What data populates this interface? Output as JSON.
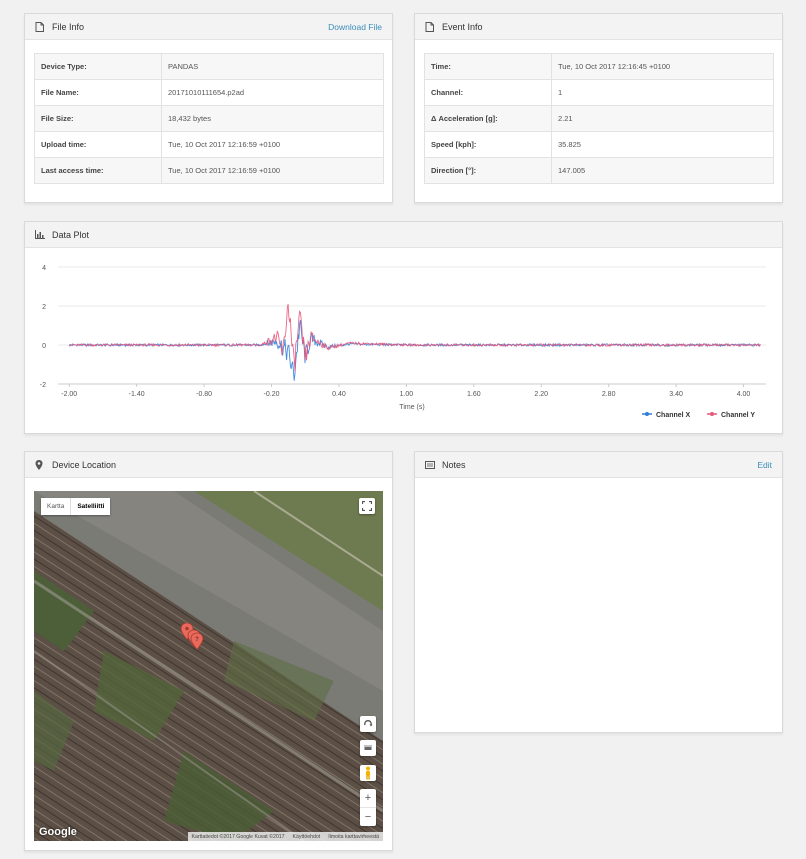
{
  "file_info": {
    "title": "File Info",
    "download_label": "Download File",
    "rows": [
      {
        "key": "Device Type:",
        "value": "PANDAS"
      },
      {
        "key": "File Name:",
        "value": "20171010111654.p2ad"
      },
      {
        "key": "File Size:",
        "value": "18,432 bytes"
      },
      {
        "key": "Upload time:",
        "value": "Tue, 10 Oct 2017 12:16:59 +0100"
      },
      {
        "key": "Last access time:",
        "value": "Tue, 10 Oct 2017 12:16:59 +0100"
      }
    ]
  },
  "event_info": {
    "title": "Event Info",
    "rows": [
      {
        "key": "Time:",
        "value": "Tue, 10 Oct 2017 12:16:45 +0100"
      },
      {
        "key": "Channel:",
        "value": "1"
      },
      {
        "key": "Δ Acceleration [g]:",
        "value": "2.21"
      },
      {
        "key": "Speed [kph]:",
        "value": "35.825"
      },
      {
        "key": "Direction [°]:",
        "value": "147.005"
      }
    ]
  },
  "data_plot": {
    "title": "Data Plot"
  },
  "chart_data": {
    "type": "line",
    "xlabel": "Time (s)",
    "ylabel": "",
    "xlim": [
      -2.1,
      4.2
    ],
    "ylim": [
      -2,
      4
    ],
    "x_ticks": [
      "-2.00",
      "-1.40",
      "-0.80",
      "-0.20",
      "0.40",
      "1.00",
      "1.60",
      "2.20",
      "2.80",
      "3.40",
      "4.00"
    ],
    "y_ticks": [
      "4",
      "2",
      "0",
      "-2"
    ],
    "legend_position": "bottom-right",
    "grid": true,
    "series": [
      {
        "name": "Channel X",
        "color": "#2f7ed8",
        "x": [
          -2.0,
          -1.0,
          -0.3,
          -0.15,
          -0.05,
          0.0,
          0.05,
          0.1,
          0.15,
          0.3,
          0.5,
          1.0,
          2.0,
          3.0,
          4.15
        ],
        "y": [
          0.0,
          0.0,
          0.0,
          0.2,
          -0.4,
          -1.6,
          1.0,
          -0.6,
          0.3,
          -0.1,
          0.05,
          0.0,
          0.0,
          0.0,
          0.0
        ]
      },
      {
        "name": "Channel Y",
        "color": "#e8577a",
        "x": [
          -2.0,
          -1.0,
          -0.3,
          -0.15,
          -0.1,
          -0.05,
          0.0,
          0.05,
          0.1,
          0.15,
          0.3,
          0.5,
          1.0,
          2.0,
          3.0,
          4.15
        ],
        "y": [
          0.0,
          0.0,
          0.0,
          0.4,
          -0.5,
          2.2,
          -1.2,
          1.4,
          -0.7,
          0.4,
          -0.15,
          0.1,
          0.0,
          0.0,
          0.0,
          0.0
        ]
      }
    ]
  },
  "device_location": {
    "title": "Device Location",
    "map_type_options": [
      "Kartta",
      "Satelliitti"
    ],
    "map_type_selected": "Satelliitti",
    "google_label": "Google",
    "attribution": "Karttatiedot ©2017 Google Kuvat ©2017",
    "terms": "Käyttöehdot",
    "report": "Ilmoita karttavirheestä",
    "zoom_in": "+",
    "zoom_out": "−"
  },
  "notes": {
    "title": "Notes",
    "edit_label": "Edit"
  }
}
